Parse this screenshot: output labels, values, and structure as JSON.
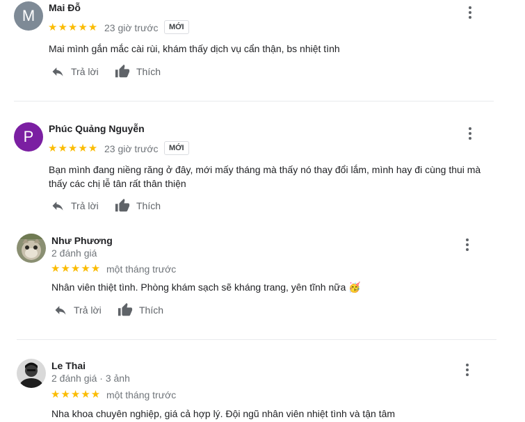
{
  "reviews": [
    {
      "avatar_letter": "M",
      "avatar_color": "#7e8a96",
      "name": "Mai Đỗ",
      "time": "23 giờ trước",
      "badge": "MỚI",
      "rating": 5,
      "stars": "★★★★★",
      "text": "Mai mình gắn mắc cài rùi, khám thấy dịch vụ cẩn thận, bs nhiệt tình",
      "reply_label": "Trả lời",
      "like_label": "Thích"
    },
    {
      "avatar_letter": "P",
      "avatar_color": "#7b1fa2",
      "name": "Phúc Quảng Nguyễn",
      "time": "23 giờ trước",
      "badge": "MỚI",
      "rating": 5,
      "stars": "★★★★★",
      "text": "Bạn mình đang niềng răng ở đây, mới mấy tháng mà thấy nó thay đổi lắm, mình hay đi cùng thui mà thấy các chị lễ tân rất thân thiện",
      "reply_label": "Trả lời",
      "like_label": "Thích"
    },
    {
      "name": "Như Phương",
      "meta": "2 đánh giá",
      "time": "một tháng trước",
      "rating": 5,
      "stars": "★★★★★",
      "text": "Nhân viên thiệt tình. Phòng khám sạch sẽ kháng trang, yên tĩnh nữa 🥳",
      "reply_label": "Trả lời",
      "like_label": "Thích"
    },
    {
      "name": "Le Thai",
      "meta": "2 đánh giá · 3 ảnh",
      "time": "một tháng trước",
      "rating": 5,
      "stars": "★★★★★",
      "text": "Nha khoa chuyên nghiệp, giá cả hợp lý. Đội ngũ nhân viên nhiệt tình và tận tâm"
    }
  ],
  "colors": {
    "star": "#fbbc04",
    "muted": "#70757a",
    "icon": "#5f6368"
  },
  "icons": [
    "reply-icon",
    "thumbs-up-icon",
    "more-vert-icon"
  ]
}
